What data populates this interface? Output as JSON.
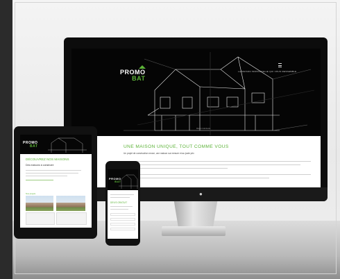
{
  "brand": {
    "line1": "PROMO",
    "line2": "BAT"
  },
  "desktop": {
    "nav_text": "LA MAISON INDIVIDUELLE QUI VOUS RESSEMBLE",
    "hero_caption": "Maison individuelle",
    "heading": "UNE MAISON UNIQUE, TOUT COMME VOUS",
    "subheading": "Un projet de construction neuve, une maison sur mesure et au juste prix"
  },
  "tablet": {
    "heading": "DÉCOUVREZ NOS MAISONS",
    "subheading": "Des maisons à construire",
    "section_label": "Nos projets"
  },
  "phone": {
    "heading": "DEVIS GRATUIT"
  },
  "colors": {
    "accent": "#5cb338",
    "dark": "#050505",
    "background": "#ececec"
  },
  "icons": [
    "house-roof-icon",
    "menu-icon",
    "apple-logo-icon"
  ]
}
